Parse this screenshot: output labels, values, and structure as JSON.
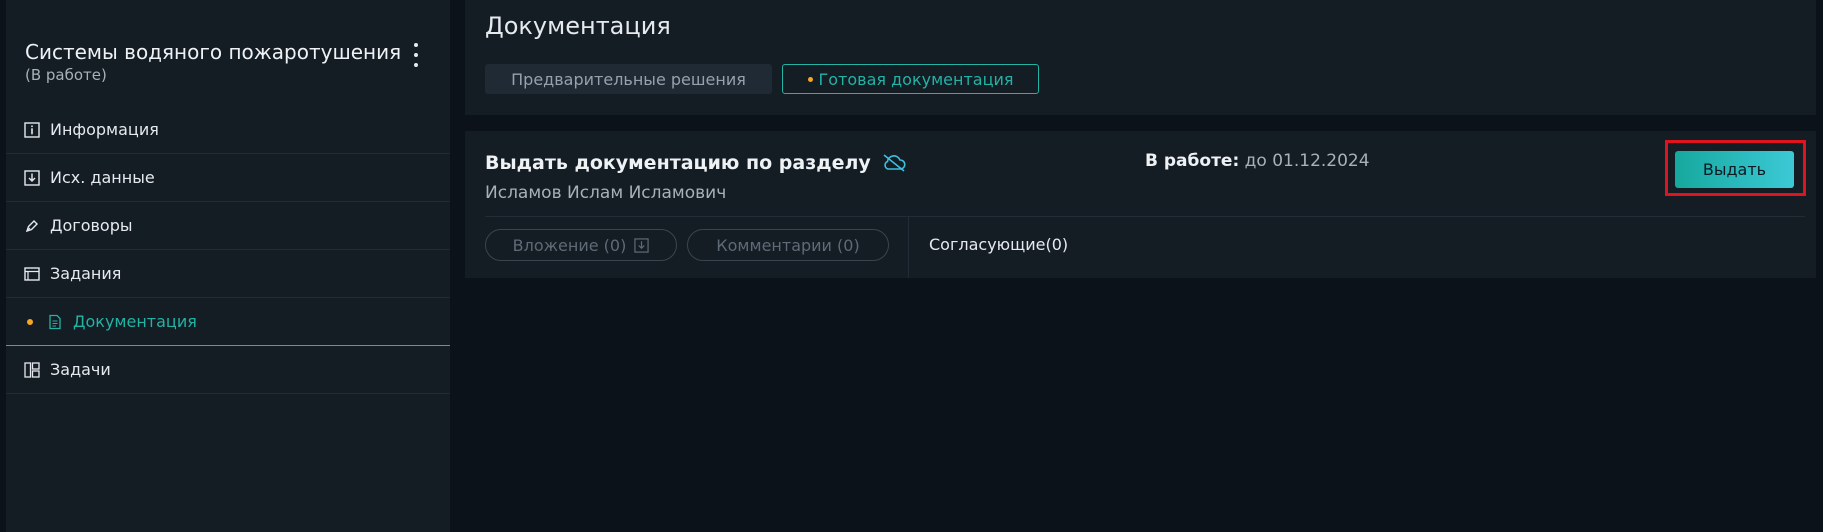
{
  "sidebar": {
    "project_title": "Системы водяного пожаротушения",
    "project_status": "(В работе)",
    "menu_icon": "kebab-menu-icon",
    "items": [
      {
        "label": "Информация",
        "icon": "info-icon"
      },
      {
        "label": "Исх. данные",
        "icon": "download-icon"
      },
      {
        "label": "Договоры",
        "icon": "pen-icon"
      },
      {
        "label": "Задания",
        "icon": "window-icon"
      },
      {
        "label": "Документация",
        "icon": "document-icon",
        "active": true
      },
      {
        "label": "Задачи",
        "icon": "layout-icon"
      }
    ]
  },
  "header": {
    "title": "Документация",
    "tabs": [
      {
        "label": "Предварительные решения"
      },
      {
        "label": "Готовая документация",
        "active": true
      }
    ]
  },
  "card": {
    "title": "Выдать документацию по разделу",
    "title_icon": "cloud-off-icon",
    "person": "Исламов Ислам Исламович",
    "status_label": "В работе:",
    "status_value": "до 01.12.2024",
    "issue_button": "Выдать",
    "attachments": "Вложение (0)",
    "comments": "Комментарии (0)",
    "approvers": "Согласующие(0)"
  },
  "colors": {
    "background": "#0c121a",
    "panel": "#141c24",
    "accent": "#22b3a5",
    "dot": "#f5a623",
    "highlight": "#e0141e"
  }
}
